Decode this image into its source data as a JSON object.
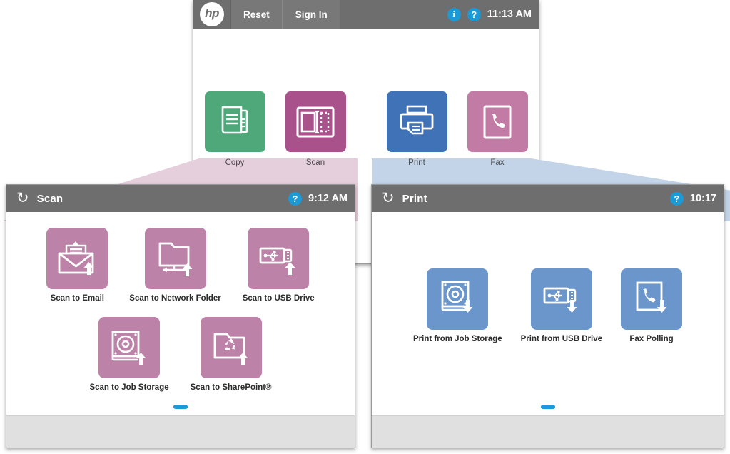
{
  "home": {
    "logo": {
      "name": "hp-logo",
      "text": "hp"
    },
    "buttons": [
      {
        "label": "Reset",
        "name": "reset-button"
      },
      {
        "label": "Sign In",
        "name": "sign-in-button"
      }
    ],
    "info_icon": "info-icon",
    "info_glyph": "i",
    "help_icon": "help-icon",
    "help_glyph": "?",
    "time": "11:13 AM",
    "tiles": [
      {
        "label": "Copy",
        "color": "#4fa87a",
        "icon": "copy-icon"
      },
      {
        "label": "Scan",
        "color": "#a8518a",
        "icon": "scan-icon"
      },
      {
        "label": "Print",
        "color": "#4072b8",
        "icon": "print-icon"
      },
      {
        "label": "Fax",
        "color": "#c17ba4",
        "icon": "fax-icon"
      }
    ]
  },
  "scan_window": {
    "back_icon": "back-arrow-icon",
    "back_glyph": "↺",
    "title": "Scan",
    "help_icon": "help-icon",
    "help_glyph": "?",
    "time": "9:12 AM",
    "tile_color": "#bd82a8",
    "row1": [
      {
        "label": "Scan to Email",
        "icon": "scan-to-email-icon"
      },
      {
        "label": "Scan to Network Folder",
        "icon": "scan-to-network-folder-icon"
      },
      {
        "label": "Scan to USB Drive",
        "icon": "scan-to-usb-drive-icon"
      }
    ],
    "row2": [
      {
        "label": "Scan to Job Storage",
        "icon": "scan-to-job-storage-icon"
      },
      {
        "label": "Scan to SharePoint®",
        "icon": "scan-to-sharepoint-icon"
      }
    ]
  },
  "print_window": {
    "back_icon": "back-arrow-icon",
    "back_glyph": "↺",
    "title": "Print",
    "help_icon": "help-icon",
    "help_glyph": "?",
    "time": "10:17",
    "tile_color": "#6b96cc",
    "row1": [
      {
        "label": "Print from Job Storage",
        "icon": "print-from-job-storage-icon"
      },
      {
        "label": "Print from USB Drive",
        "icon": "print-from-usb-drive-icon"
      },
      {
        "label": "Fax Polling",
        "icon": "fax-polling-icon"
      }
    ]
  },
  "colors": {
    "titlebar": "#6e6e6e",
    "accent_blue": "#1b9ad6",
    "wedge_pink": "#e6cfdd",
    "wedge_blue": "#c4d4e8",
    "footer": "#e0e0e0"
  }
}
